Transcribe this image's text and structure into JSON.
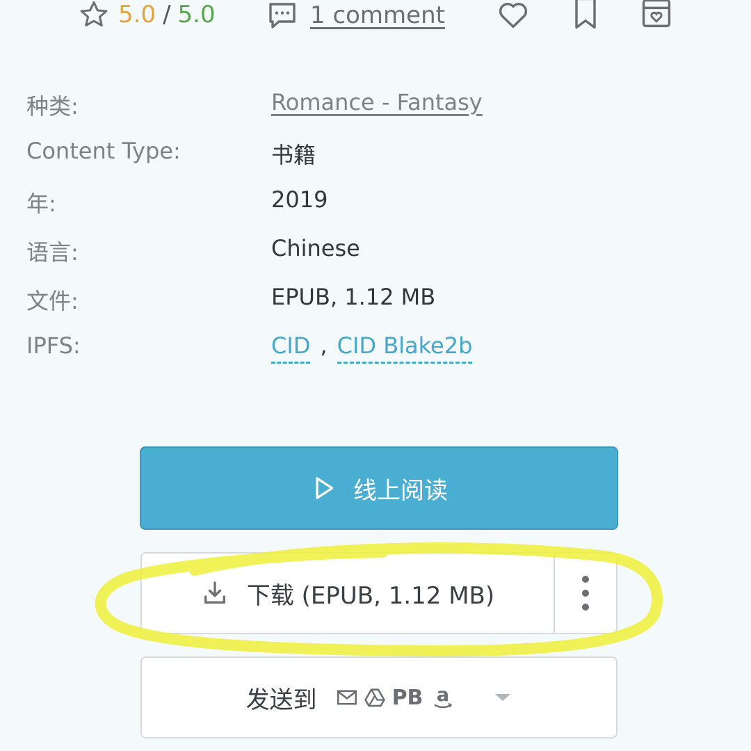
{
  "topbar": {
    "rating_value": "5.0",
    "rating_separator": "/",
    "rating_max": "5.0",
    "comments_label": "1 comment",
    "colors": {
      "rating": "#e4a23a",
      "rating_max": "#55a84a"
    }
  },
  "details": [
    {
      "label": "种类:",
      "value": "Romance - Fantasy"
    },
    {
      "label": "Content Type:",
      "value": "书籍"
    },
    {
      "label": "年:",
      "value": "2019"
    },
    {
      "label": "语言:",
      "value": "Chinese"
    },
    {
      "label": "文件:",
      "value": "EPUB, 1.12 MB"
    },
    {
      "label": "IPFS:",
      "links": [
        "CID",
        "CID Blake2b"
      ],
      "separator": ","
    }
  ],
  "buttons": {
    "read_online": "线上阅读",
    "download": "下载 (EPUB, 1.12 MB)",
    "send_to": "发送到",
    "send_services": [
      "email-icon",
      "google-drive-icon",
      "PB",
      "amazon-icon"
    ]
  },
  "colors": {
    "accent": "#4aaed3",
    "link": "#47a6c9",
    "highlight": "#eef03a",
    "background": "#f4f9fb"
  }
}
